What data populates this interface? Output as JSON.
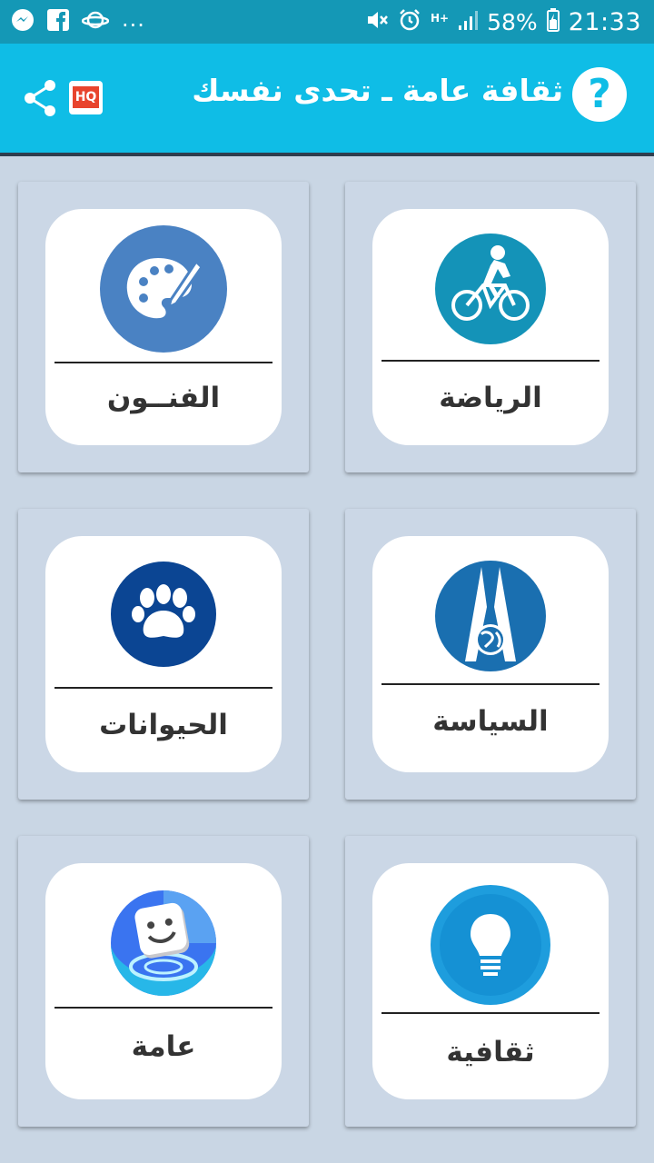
{
  "status_bar": {
    "time": "21:33",
    "battery": "58%",
    "overflow": "...",
    "network": "H+",
    "icons": [
      "messenger-icon",
      "facebook-icon",
      "saturn-icon",
      "mute-icon",
      "alarm-icon",
      "signal-icon",
      "battery-icon"
    ]
  },
  "app_bar": {
    "title": "ثقافة عامة ـ تحدى نفسك",
    "help_glyph": "?",
    "hq_label": "HQ",
    "colors": {
      "bar": "#0fbde6",
      "status": "#1498b6"
    }
  },
  "categories": [
    {
      "label": "الرياضة",
      "icon": "cyclist-icon",
      "color": "#1493b8"
    },
    {
      "label": "الفنــون",
      "icon": "palette-icon",
      "color": "#4a82c3"
    },
    {
      "label": "السياسة",
      "icon": "politics-globe-icon",
      "color": "#1a6fb0"
    },
    {
      "label": "الحيوانات",
      "icon": "paw-icon",
      "color": "#0b4593"
    },
    {
      "label": "ثقافية",
      "icon": "lightbulb-icon",
      "color": "#1e9ddd"
    },
    {
      "label": "عامة",
      "icon": "smiley-cube-icon",
      "color": "#3a74f0"
    }
  ]
}
